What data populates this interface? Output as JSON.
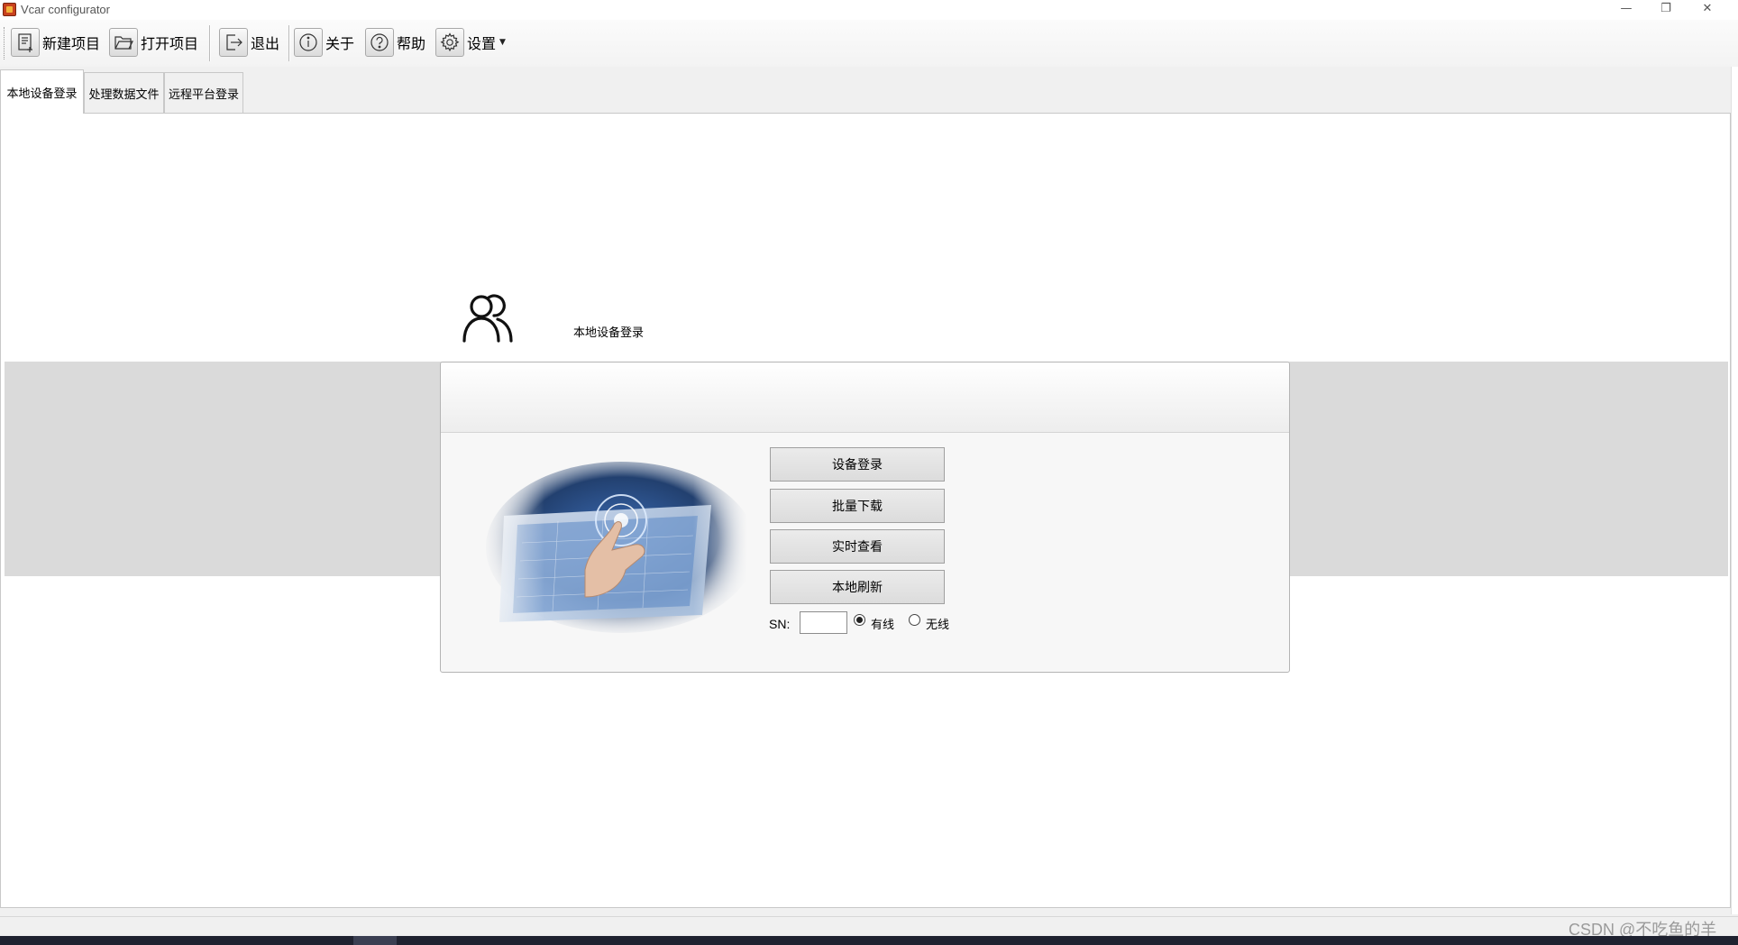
{
  "window": {
    "title": "Vcar configurator",
    "controls": {
      "minimize": "—",
      "restore": "❐",
      "close": "✕"
    }
  },
  "toolbar": {
    "new_project": {
      "label": "新建项目",
      "icon": "new-document-icon"
    },
    "open_project": {
      "label": "打开项目",
      "icon": "open-folder-icon"
    },
    "exit": {
      "label": "退出",
      "icon": "exit-icon"
    },
    "about": {
      "label": "关于",
      "icon": "info-icon"
    },
    "help": {
      "label": "帮助",
      "icon": "help-icon"
    },
    "settings": {
      "label": "设置",
      "icon": "gear-icon",
      "has_dropdown": true
    }
  },
  "tabs": [
    {
      "label": "本地设备登录",
      "active": true
    },
    {
      "label": "处理数据文件",
      "active": false
    },
    {
      "label": "远程平台登录",
      "active": false
    }
  ],
  "login_panel": {
    "title": "本地设备登录",
    "icon": "users-icon",
    "buttons": {
      "device_login": "设备登录",
      "batch_download": "批量下载",
      "realtime_view": "实时查看",
      "local_refresh": "本地刷新"
    },
    "sn": {
      "label": "SN:",
      "value": ""
    },
    "connection": {
      "wired_label": "有线",
      "wireless_label": "无线",
      "selected": "有线"
    }
  },
  "watermark": "CSDN @不吃鱼的羊",
  "colors": {
    "band_grey": "#dadada",
    "card_bg": "#f7f7f7",
    "button_bg": "#e2e2e2",
    "taskbar": "#1f2230"
  }
}
